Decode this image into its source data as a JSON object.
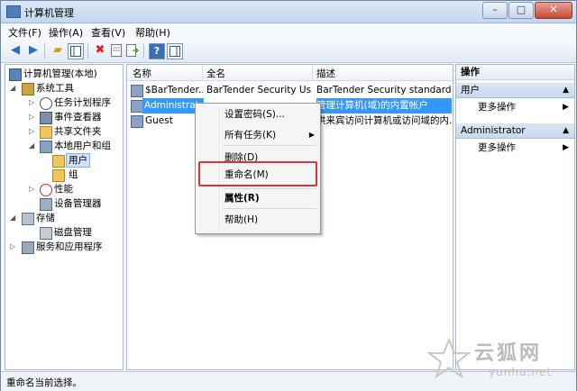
{
  "window": {
    "title": "计算机管理"
  },
  "window_controls": {
    "minimize": "–",
    "maximize": "□",
    "close": "✕"
  },
  "menu": [
    "文件(F)",
    "操作(A)",
    "查看(V)",
    "帮助(H)"
  ],
  "toolbar_icons": [
    "back-arrow-icon",
    "forward-arrow-icon",
    "up-folder-icon",
    "show-hide-tree-icon",
    "delete-icon",
    "properties-icon",
    "export-icon",
    "help-icon",
    "action-pane-icon"
  ],
  "tree": {
    "root": "计算机管理(本地)",
    "system_tools": "系统工具",
    "task_scheduler": "任务计划程序",
    "event_viewer": "事件查看器",
    "shared_folders": "共享文件夹",
    "local_users_groups": "本地用户和组",
    "users": "用户",
    "groups": "组",
    "performance": "性能",
    "device_manager": "设备管理器",
    "storage": "存储",
    "disk_management": "磁盘管理",
    "services_apps": "服务和应用程序"
  },
  "list": {
    "columns": [
      "名称",
      "全名",
      "描述"
    ],
    "rows": [
      {
        "name": "$BarTender...",
        "fullname": "BarTender Security Us...",
        "desc": "BarTender Security standard u..."
      },
      {
        "name": "Administrat...",
        "fullname": "",
        "desc": "管理计算机(域)的内置帐户"
      },
      {
        "name": "Guest",
        "fullname": "",
        "desc": "供来宾访问计算机或访问域的内..."
      }
    ]
  },
  "context_menu": {
    "set_password": "设置密码(S)...",
    "all_tasks": "所有任务(K)",
    "delete": "删除(D)",
    "rename": "重命名(M)",
    "properties": "属性(R)",
    "help": "帮助(H)"
  },
  "actions": {
    "header": "操作",
    "section1": "用户",
    "more1": "更多操作",
    "section2": "Administrator",
    "more2": "更多操作"
  },
  "status": "重命名当前选择。",
  "watermark": {
    "cn": "云狐网",
    "en": "yunhu.net"
  },
  "colors": {
    "selection": "#3399ff",
    "highlight_box": "#d9343a"
  }
}
